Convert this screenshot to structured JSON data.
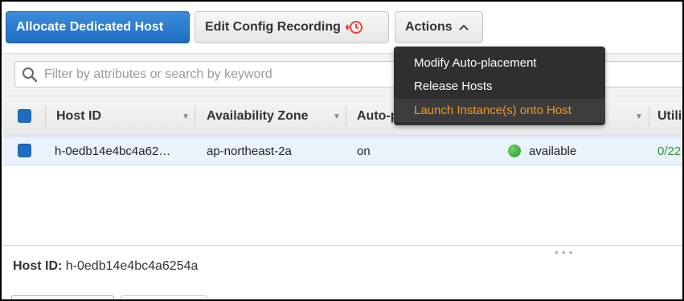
{
  "toolbar": {
    "allocate_label": "Allocate Dedicated Host",
    "edit_config_label": "Edit Config Recording",
    "actions_label": "Actions"
  },
  "search": {
    "placeholder": "Filter by attributes or search by keyword"
  },
  "table": {
    "columns": [
      "Host ID",
      "Availability Zone",
      "Auto-p",
      "Utiliz"
    ],
    "rows": [
      {
        "host_id": "h-0edb14e4bc4a62…",
        "availability_zone": "ap-northeast-2a",
        "auto_placement": "on",
        "state": "available",
        "utilization": "0/22"
      }
    ]
  },
  "actions_menu": {
    "items": [
      {
        "label": "Modify Auto-placement"
      },
      {
        "label": "Release Hosts"
      },
      {
        "label": "Launch Instance(s) onto Host"
      }
    ]
  },
  "detail": {
    "label": "Host ID:",
    "value": "h-0edb14e4bc4a6254a"
  },
  "colors": {
    "primary": "#1f6cc1",
    "menu_bg": "#2f2f2f",
    "menu_highlight": "#ec9a2c",
    "status_green": "#2a9a2a"
  }
}
